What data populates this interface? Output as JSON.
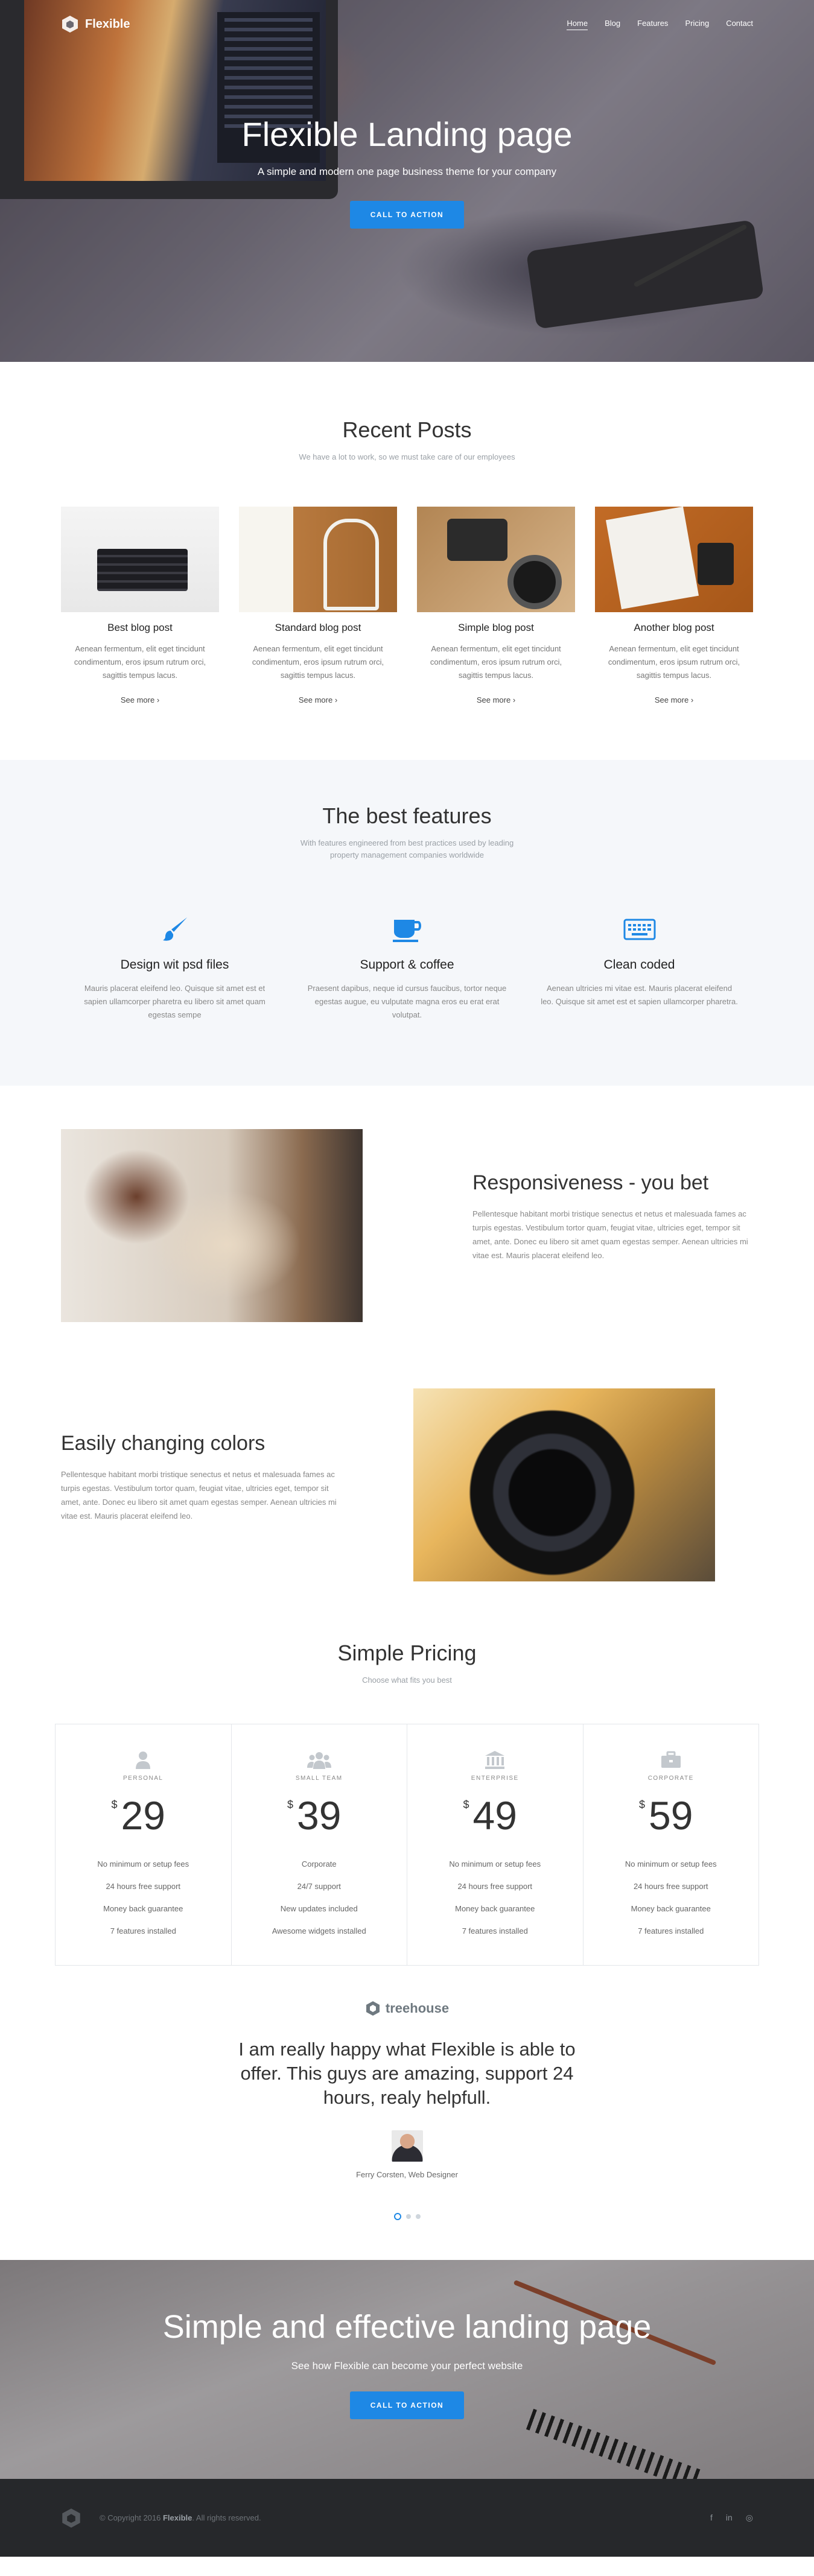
{
  "brand": {
    "name": "Flexible"
  },
  "nav": {
    "items": [
      "Home",
      "Blog",
      "Features",
      "Pricing",
      "Contact"
    ]
  },
  "hero": {
    "title": "Flexible Landing page",
    "subtitle": "A simple and modern one page business theme for your company",
    "button": "CALL TO ACTION"
  },
  "posts": {
    "title": "Recent Posts",
    "subtitle": "We have a lot to work, so we must take care of our employees",
    "items": [
      {
        "title": "Best blog post",
        "text": "Aenean fermentum, elit eget tincidunt condimentum, eros ipsum rutrum orci, sagittis tempus lacus.",
        "more": "See more ›"
      },
      {
        "title": "Standard blog post",
        "text": "Aenean fermentum, elit eget tincidunt condimentum, eros ipsum rutrum orci, sagittis tempus lacus.",
        "more": "See more ›"
      },
      {
        "title": "Simple blog post",
        "text": "Aenean fermentum, elit eget tincidunt condimentum, eros ipsum rutrum orci, sagittis tempus lacus.",
        "more": "See more ›"
      },
      {
        "title": "Another blog post",
        "text": "Aenean fermentum, elit eget tincidunt condimentum, eros ipsum rutrum orci, sagittis tempus lacus.",
        "more": "See more ›"
      }
    ]
  },
  "features": {
    "title": "The best features",
    "subtitle1": "With features engineered from best practices used by leading",
    "subtitle2": "property management companies worldwide",
    "items": [
      {
        "icon": "paint-brush-icon",
        "title": "Design wit psd files",
        "text": "Mauris placerat eleifend leo. Quisque sit amet est et sapien ullamcorper pharetra eu libero sit amet quam egestas sempe"
      },
      {
        "icon": "coffee-icon",
        "title": "Support & coffee",
        "text": "Praesent dapibus, neque id cursus faucibus, tortor neque egestas augue, eu vulputate magna eros eu erat erat volutpat."
      },
      {
        "icon": "keyboard-icon",
        "title": "Clean coded",
        "text": "Aenean ultricies mi vitae est. Mauris placerat eleifend leo. Quisque sit amet est et sapien ullamcorper pharetra."
      }
    ]
  },
  "responsive": {
    "title": "Responsiveness - you bet",
    "text": "Pellentesque habitant morbi tristique senectus et netus et malesuada fames ac turpis egestas. Vestibulum tortor quam, feugiat vitae, ultricies eget, tempor sit amet, ante. Donec eu libero sit amet quam egestas semper. Aenean ultricies mi vitae est. Mauris placerat eleifend leo."
  },
  "colors": {
    "title": "Easily changing colors",
    "text": "Pellentesque habitant morbi tristique senectus et netus et malesuada fames ac turpis egestas. Vestibulum tortor quam, feugiat vitae, ultricies eget, tempor sit amet, ante. Donec eu libero sit amet quam egestas semper. Aenean ultricies mi vitae est. Mauris placerat eleifend leo."
  },
  "pricing": {
    "title": "Simple Pricing",
    "subtitle": "Choose what fits you best",
    "currency": "$",
    "plans": [
      {
        "icon": "user-icon",
        "name": "PERSONAL",
        "price": "29",
        "features": [
          "No minimum or setup fees",
          "24 hours free support",
          "Money back guarantee",
          "7 features installed"
        ]
      },
      {
        "icon": "team-icon",
        "name": "SMALL TEAM",
        "price": "39",
        "features": [
          "Corporate",
          "24/7 support",
          "New updates included",
          "Awesome widgets installed"
        ]
      },
      {
        "icon": "bank-icon",
        "name": "ENTERPRISE",
        "price": "49",
        "features": [
          "No minimum or setup fees",
          "24 hours free support",
          "Money back guarantee",
          "7 features installed"
        ]
      },
      {
        "icon": "briefcase-icon",
        "name": "CORPORATE",
        "price": "59",
        "features": [
          "No minimum or setup fees",
          "24 hours free support",
          "Money back guarantee",
          "7 features installed"
        ]
      }
    ]
  },
  "testimonial": {
    "logo": "treehouse",
    "quote": "I am really happy what Flexible is able to offer. This guys are amazing, support 24 hours, realy helpfull.",
    "author": "Ferry Corsten, Web Designer"
  },
  "cta": {
    "title": "Simple and effective landing page",
    "subtitle": "See how Flexible can become your perfect website",
    "button": "CALL TO ACTION"
  },
  "footer": {
    "copyright_prefix": "© Copyright 2016",
    "brand": "Flexible",
    "copyright_suffix": ". All rights reserved.",
    "social": [
      "f",
      "in",
      "◎"
    ]
  },
  "colors_theme": {
    "accent": "#1e88e5",
    "footer_bg": "#26282b",
    "features_bg": "#f5f7fa"
  }
}
